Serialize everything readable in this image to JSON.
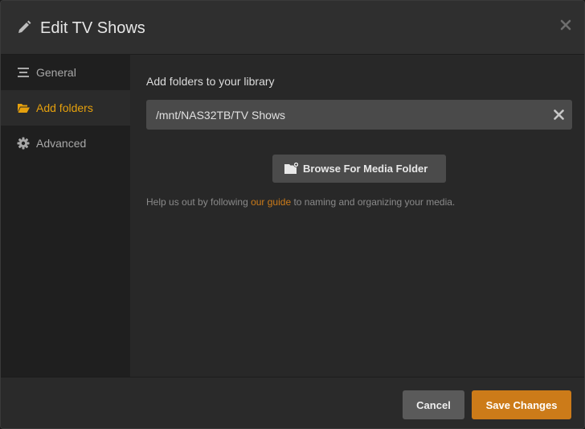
{
  "dialog": {
    "title": "Edit TV Shows"
  },
  "sidebar": {
    "items": [
      {
        "label": "General",
        "icon": "list-icon"
      },
      {
        "label": "Add folders",
        "icon": "folder-open-icon",
        "active": true
      },
      {
        "label": "Advanced",
        "icon": "gear-icon"
      }
    ]
  },
  "content": {
    "section_label": "Add folders to your library",
    "folder_path": "/mnt/NAS32TB/TV Shows",
    "browse_label": "Browse For Media Folder",
    "help": {
      "prefix": "Help us out by following ",
      "link": "our guide",
      "suffix": " to naming and organizing your media."
    }
  },
  "footer": {
    "cancel_label": "Cancel",
    "save_label": "Save Changes"
  },
  "colors": {
    "accent": "#e5a00d",
    "save_button": "#cc7b19",
    "link": "#cc7b19"
  }
}
